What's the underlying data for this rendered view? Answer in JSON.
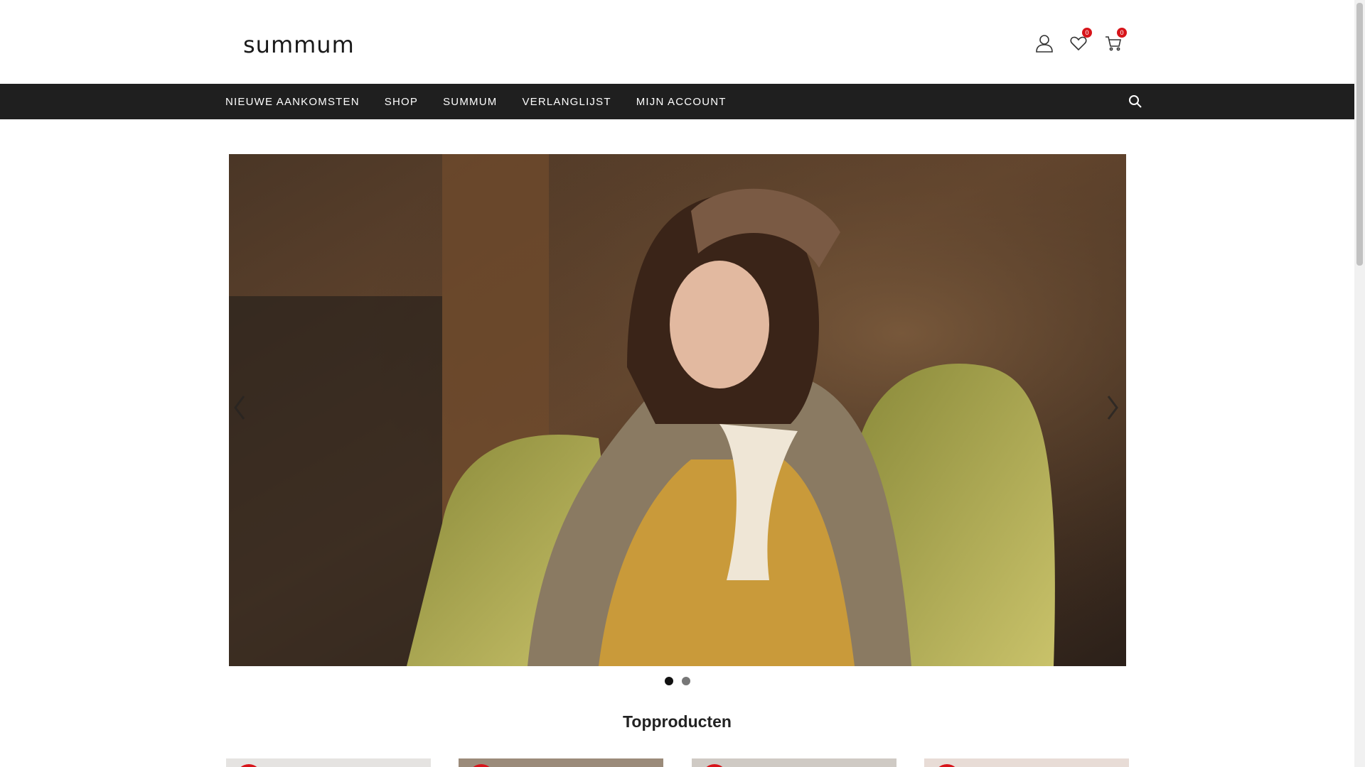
{
  "header": {
    "logo_text": "summum",
    "icons": {
      "account": "user-icon",
      "wishlist": "heart-icon",
      "cart": "cart-icon"
    },
    "wishlist_count": "0",
    "cart_count": "0"
  },
  "nav": {
    "items": [
      {
        "label": "NIEUWE AANKOMSTEN"
      },
      {
        "label": "SHOP"
      },
      {
        "label": "SUMMUM"
      },
      {
        "label": "VERLANGLIJST"
      },
      {
        "label": "MIJN ACCOUNT"
      }
    ],
    "search_icon": "search-icon"
  },
  "slider": {
    "current_slide": 1,
    "slide_count": 2,
    "prev_icon": "chevron-left-icon",
    "next_icon": "chevron-right-icon"
  },
  "sections": {
    "top_products_title": "Topproducten"
  },
  "colors": {
    "nav_bg": "#1f1f1f",
    "badge": "#d7141a",
    "text": "#222222"
  }
}
